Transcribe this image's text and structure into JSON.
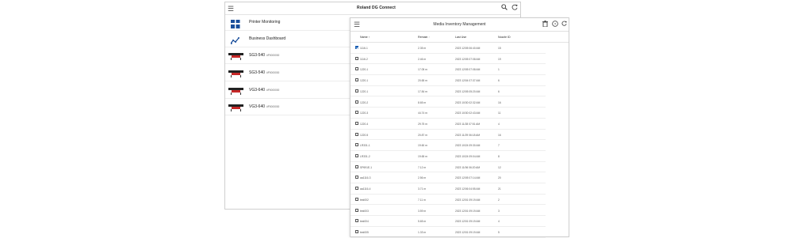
{
  "back_window": {
    "brand": "Roland DG Connect",
    "nav": [
      {
        "label": "Printer Monitoring"
      },
      {
        "label": "Business Dashboard"
      }
    ],
    "printers": [
      {
        "model": "SG3-540",
        "serial": "#P0000000"
      },
      {
        "model": "SG3-540",
        "serial": "#P0000000"
      },
      {
        "model": "VG3-640",
        "serial": "#P0000000"
      },
      {
        "model": "VG3-640",
        "serial": "#P0000000"
      }
    ]
  },
  "front_window": {
    "title": "Media Inventory Management",
    "columns": {
      "name": "Name",
      "remain": "Remain",
      "last_use": "Last Use",
      "nozzle": "Nozzle ID"
    },
    "rows": [
      {
        "name": "1116-1",
        "remain": "2.35 m",
        "last_use": "2023 12/05 06:40 AM",
        "nozzle": "15",
        "checked": true
      },
      {
        "name": "1116-2",
        "remain": "2.46 m",
        "last_use": "2023 12/05 07:08 AM",
        "nozzle": "19",
        "checked": false
      },
      {
        "name": "1220-1",
        "remain": "17.05 m",
        "last_use": "2023 12/05 07:08 AM",
        "nozzle": "1",
        "checked": false
      },
      {
        "name": "1220-1",
        "remain": "20.65 m",
        "last_use": "2023 12/04 07:37 AM",
        "nozzle": "6",
        "checked": false
      },
      {
        "name": "1220-1",
        "remain": "17.84 m",
        "last_use": "2023 12/05 05:20 AM",
        "nozzle": "6",
        "checked": false
      },
      {
        "name": "1220-2",
        "remain": "8.65 m",
        "last_use": "2023 10/30 02:32 AM",
        "nozzle": "16",
        "checked": false
      },
      {
        "name": "1220-3",
        "remain": "44.74 m",
        "last_use": "2023 10/30 02:43 AM",
        "nozzle": "11",
        "checked": false
      },
      {
        "name": "1220-4",
        "remain": "29.75 m",
        "last_use": "2023 11/28 07:51 AM",
        "nozzle": "4",
        "checked": false
      },
      {
        "name": "1220-5",
        "remain": "20.87 m",
        "last_use": "2023 11/29 06:18 AM",
        "nozzle": "16",
        "checked": false
      },
      {
        "name": "LR331-1",
        "remain": "19.60 m",
        "last_use": "2023 10/24 09:30 AM",
        "nozzle": "7",
        "checked": false
      },
      {
        "name": "LR331-2",
        "remain": "19.65 m",
        "last_use": "2023 10/24 09:04 AM",
        "nozzle": "8",
        "checked": false
      },
      {
        "name": "SP691E-1",
        "remain": "7.12 m",
        "last_use": "2023 11/06 06:20 AM",
        "nozzle": "12",
        "checked": false
      },
      {
        "name": "aa1116-3",
        "remain": "2.56 m",
        "last_use": "2023 12/05 07:14 AM",
        "nozzle": "20",
        "checked": false
      },
      {
        "name": "aa1116-4",
        "remain": "3.71 m",
        "last_use": "2023 12/06 04:55 AM",
        "nozzle": "21",
        "checked": false
      },
      {
        "name": "test002",
        "remain": "7.11 m",
        "last_use": "2023 12/01 09:19 AM",
        "nozzle": "2",
        "checked": false
      },
      {
        "name": "test003",
        "remain": "3.59 m",
        "last_use": "2023 12/01 09:19 AM",
        "nozzle": "3",
        "checked": false
      },
      {
        "name": "test004",
        "remain": "5.65 m",
        "last_use": "2023 12/01 09:19 AM",
        "nozzle": "4",
        "checked": false
      },
      {
        "name": "test005",
        "remain": "1.33 m",
        "last_use": "2023 12/01 09:19 AM",
        "nozzle": "5",
        "checked": false
      }
    ]
  },
  "colors": {
    "accent": "#1a5fb4",
    "printer_red": "#c62828"
  }
}
